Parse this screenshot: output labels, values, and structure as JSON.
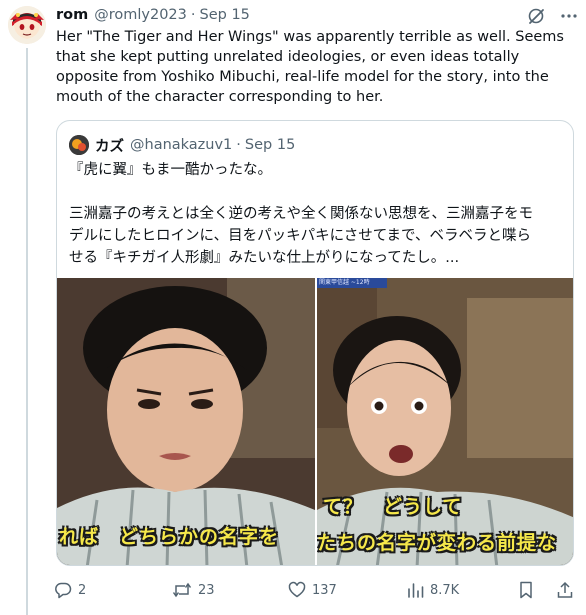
{
  "tweet": {
    "author_name": "rom",
    "handle": "@romly2023",
    "separator": "·",
    "date": "Sep 15",
    "text": "Her \"The Tiger and Her Wings\" was apparently terrible as well. Seems that she kept putting unrelated ideologies, or even ideas totally opposite from Yoshiko Mibuchi, real-life model for the story, into the mouth of the character corresponding to her."
  },
  "quoted": {
    "author_name": "カズ",
    "handle": "@hanakazuv1",
    "separator": "·",
    "date": "Sep 15",
    "lines": [
      "『虎に翼』もま一酷かったな。",
      "",
      "三淵嘉子の考えとは全く逆の考えや全く関係ない思想を、三淵嘉子をモ",
      "デルにしたヒロインに、目をパッキパキにさせてまで、ベラベラと喋ら",
      "せる『キチガイ人形劇』みたいな仕上がりになってたし。..."
    ],
    "media": {
      "left_subtitle": "れば　どちらかの名字を",
      "right_subtitle_top": "て？　どうして",
      "right_subtitle_bottom": "たちの名字が変わる前提な",
      "right_badge": "関東甲信越 ~12時"
    }
  },
  "actions": {
    "replies": "2",
    "reposts": "23",
    "likes": "137",
    "views": "8.7K"
  },
  "icons": {
    "avatar": "yukkuri-avatar",
    "grok": "grok-icon",
    "more": "more-icon",
    "reply": "reply-icon",
    "repost": "repost-icon",
    "like": "heart-icon",
    "views": "views-icon",
    "bookmark": "bookmark-icon",
    "share": "share-icon"
  },
  "colors": {
    "secondary_text": "#536471",
    "border": "#cfd9de",
    "subtitle": "#f6e84a"
  }
}
